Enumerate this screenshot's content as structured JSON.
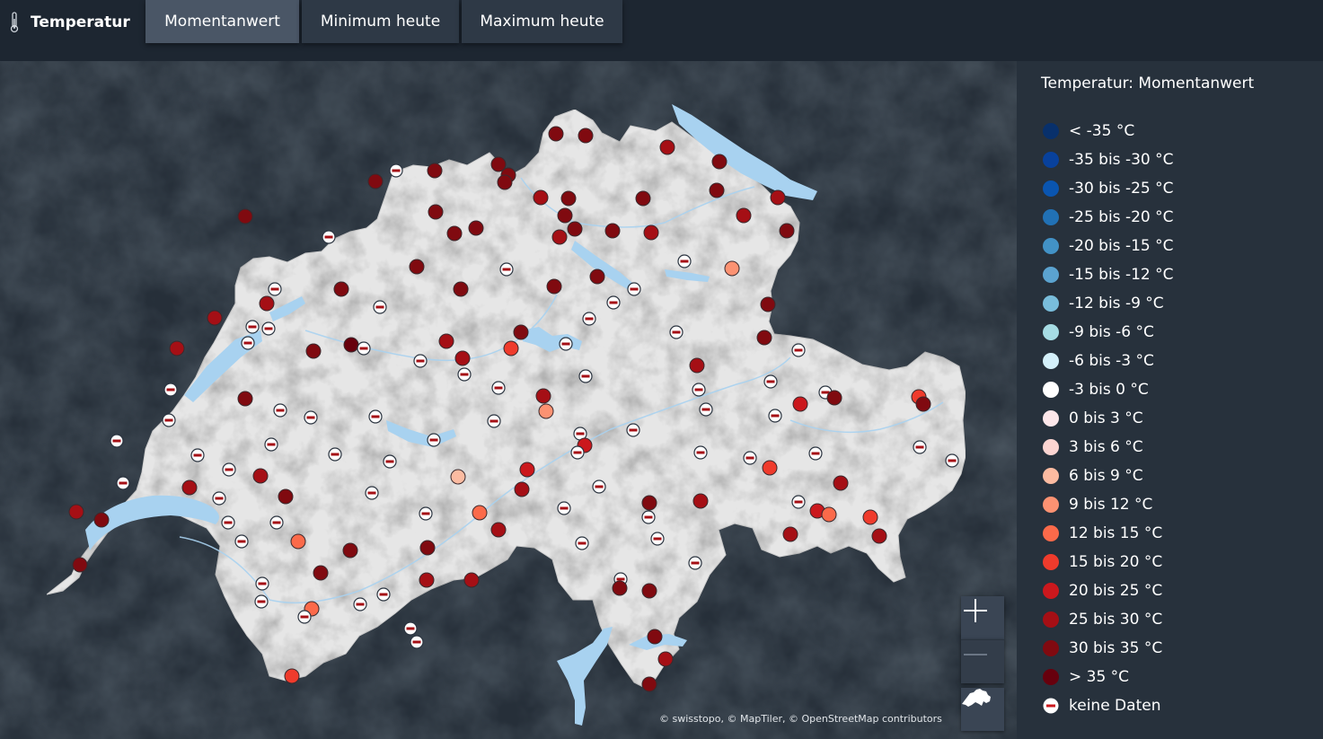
{
  "header": {
    "title": "Temperatur",
    "tabs": [
      {
        "label": "Momentanwert",
        "active": true
      },
      {
        "label": "Minimum heute",
        "active": false
      },
      {
        "label": "Maximum heute",
        "active": false
      }
    ]
  },
  "legend": {
    "title": "Temperatur: Momentanwert",
    "items": [
      {
        "label": "< -35 °C",
        "color": "#08306b"
      },
      {
        "label": "-35 bis -30 °C",
        "color": "#08419c"
      },
      {
        "label": "-30 bis -25 °C",
        "color": "#0a55b0"
      },
      {
        "label": "-25 bis -20 °C",
        "color": "#2171b5"
      },
      {
        "label": "-20 bis -15 °C",
        "color": "#4292c6"
      },
      {
        "label": "-15 bis -12 °C",
        "color": "#5ba3d0"
      },
      {
        "label": "-12 bis -9 °C",
        "color": "#79bddb"
      },
      {
        "label": "-9 bis -6 °C",
        "color": "#a6dce4"
      },
      {
        "label": "-6 bis -3 °C",
        "color": "#d4f0fa"
      },
      {
        "label": "-3 bis 0 °C",
        "color": "#ffffff"
      },
      {
        "label": "0 bis 3 °C",
        "color": "#fde7ea"
      },
      {
        "label": "3 bis 6 °C",
        "color": "#fcd5d2"
      },
      {
        "label": "6 bis 9 °C",
        "color": "#fcbba1"
      },
      {
        "label": "9 bis 12 °C",
        "color": "#fc9272"
      },
      {
        "label": "12 bis 15 °C",
        "color": "#fb6a4a"
      },
      {
        "label": "15 bis 20 °C",
        "color": "#ef3b2c"
      },
      {
        "label": "20 bis 25 °C",
        "color": "#cb181d"
      },
      {
        "label": "25 bis 30 °C",
        "color": "#a50f15"
      },
      {
        "label": "30 bis 35 °C",
        "color": "#800a10"
      },
      {
        "label": "> 35 °C",
        "color": "#67000d"
      },
      {
        "label": "keine Daten",
        "nodata": true
      }
    ]
  },
  "map": {
    "attribution": "© swisstopo, © MapTiler, © OpenStreetMap contributors",
    "water_color": "#a8d2f0",
    "land_color": "#e8e8e8"
  },
  "controls": {
    "zoom_in": "zoom-in",
    "zoom_out": "zoom-out",
    "reset": "switzerland-outline-icon"
  }
}
